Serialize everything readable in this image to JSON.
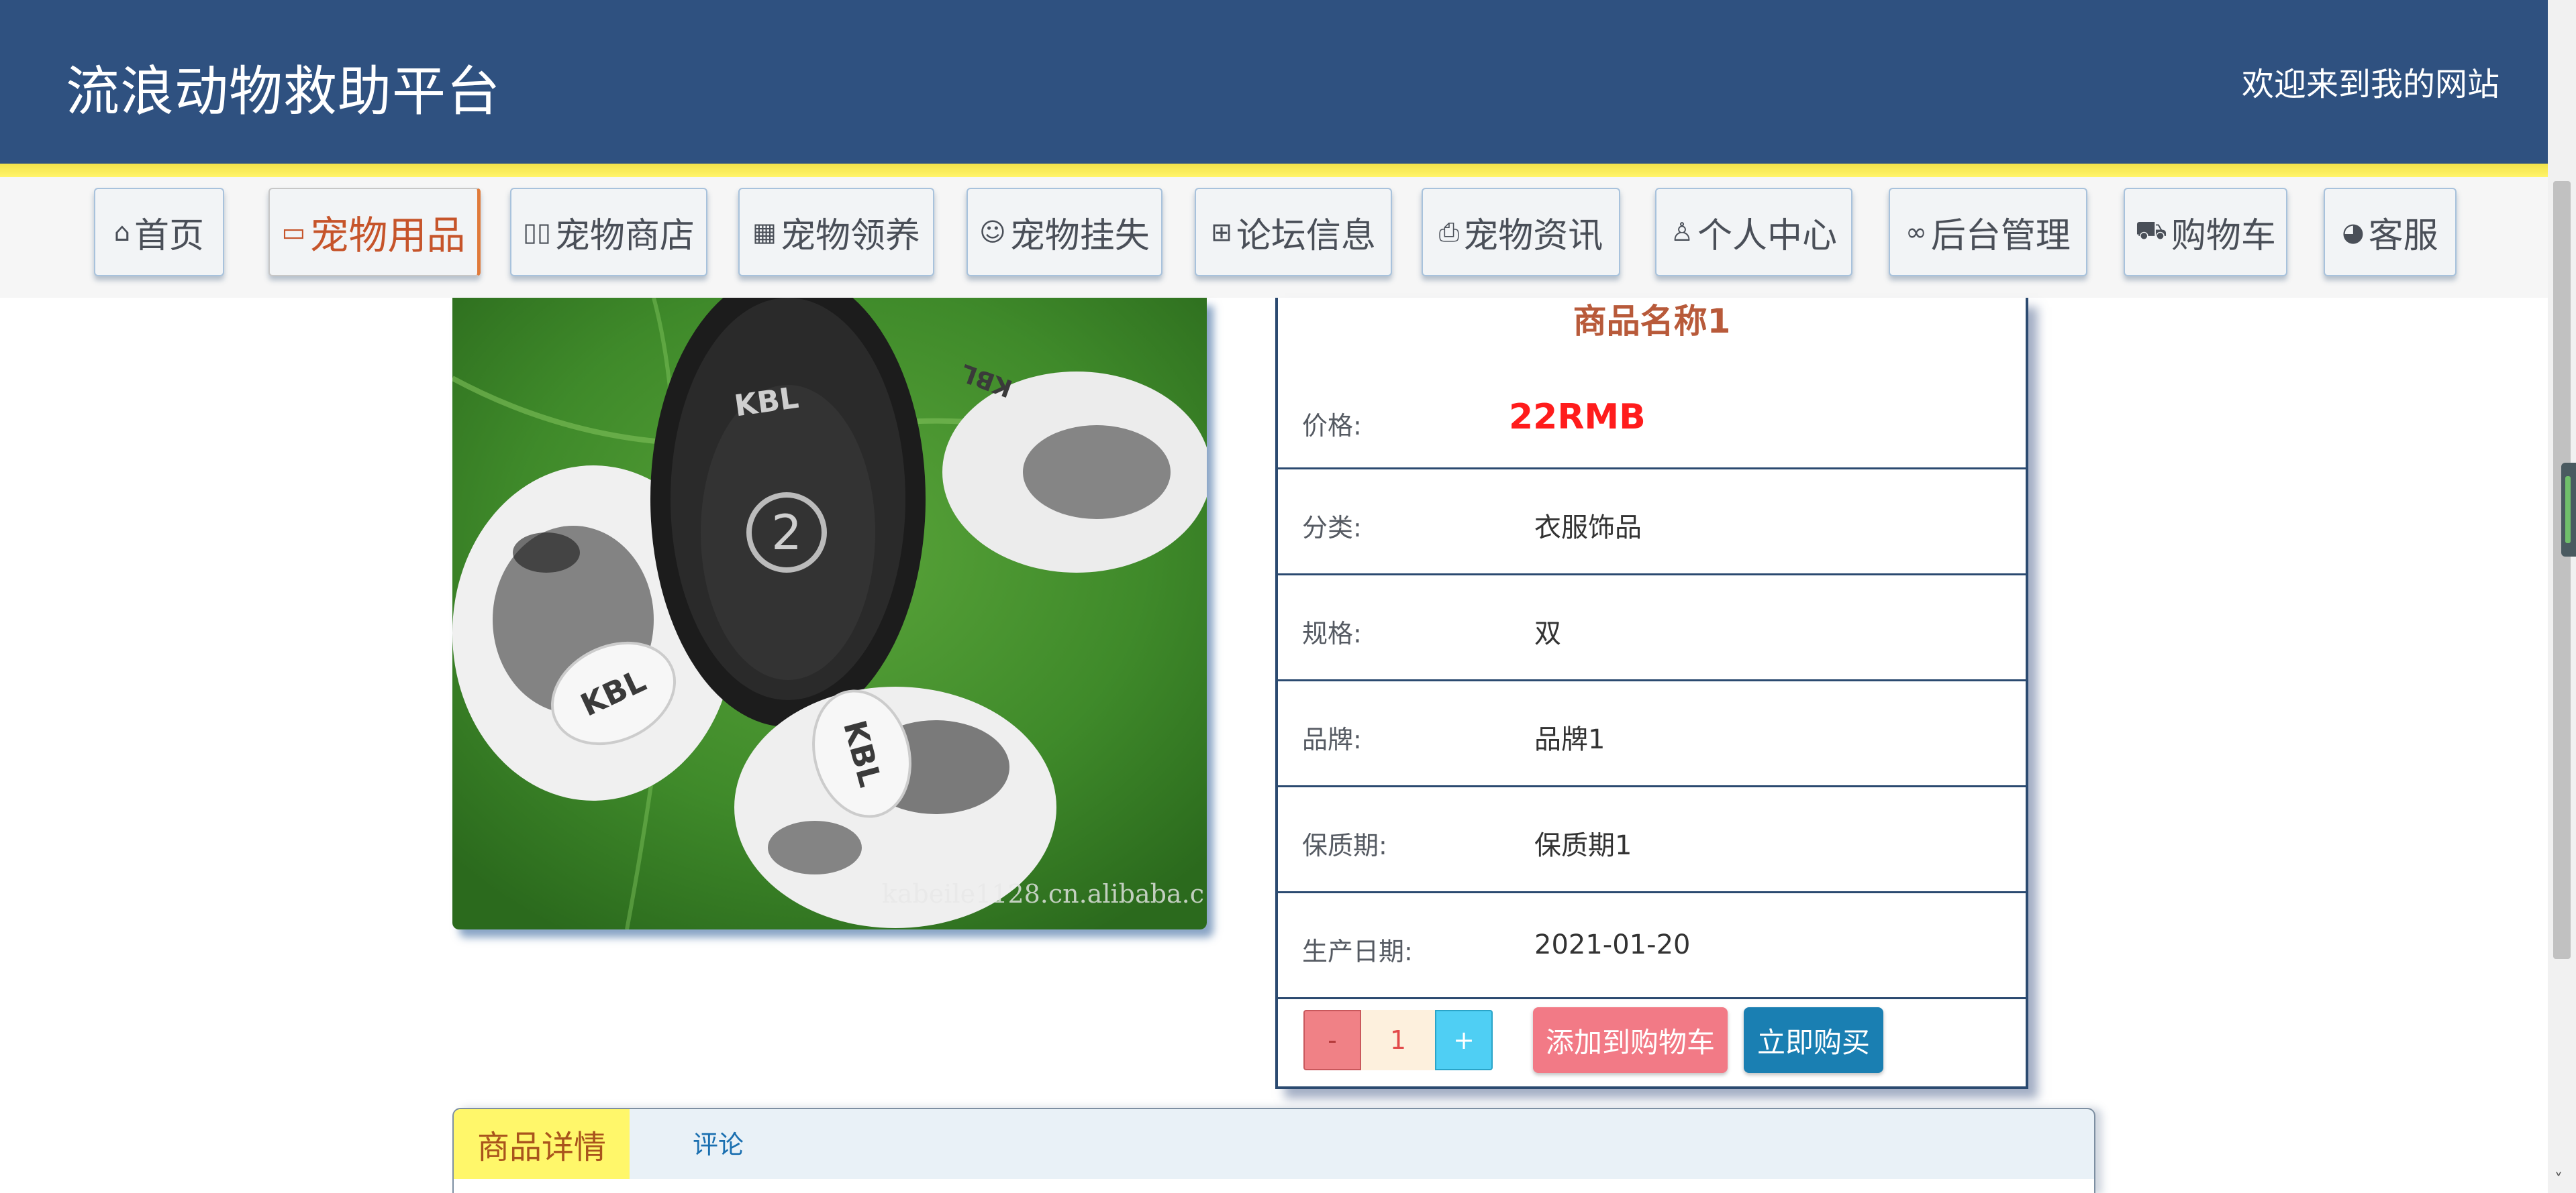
{
  "header": {
    "site_title": "流浪动物救助平台",
    "welcome": "欢迎来到我的网站"
  },
  "nav": {
    "items": [
      {
        "label": "首页",
        "icon": "home-icon",
        "glyph": "⌂"
      },
      {
        "label": "宠物用品",
        "icon": "document-icon",
        "glyph": "🗋"
      },
      {
        "label": "宠物商店",
        "icon": "columns-icon",
        "glyph": "▯▯"
      },
      {
        "label": "宠物领养",
        "icon": "grid-icon",
        "glyph": "▦"
      },
      {
        "label": "宠物挂失",
        "icon": "face-icon",
        "glyph": "☺"
      },
      {
        "label": "论坛信息",
        "icon": "apps-icon",
        "glyph": "⊞"
      },
      {
        "label": "宠物资讯",
        "icon": "printer-icon",
        "glyph": "⎙"
      },
      {
        "label": "个人中心",
        "icon": "user-icon",
        "glyph": "♙"
      },
      {
        "label": "后台管理",
        "icon": "link-icon",
        "glyph": "🔗"
      },
      {
        "label": "购物车",
        "icon": "cart-icon",
        "glyph": "🛒"
      },
      {
        "label": "客服",
        "icon": "chat-icon",
        "glyph": "◕"
      }
    ],
    "active_index": 1
  },
  "product": {
    "name": "商品名称1",
    "price_label": "价格:",
    "price": "22RMB",
    "category_label": "分类:",
    "category": "衣服饰品",
    "spec_label": "规格:",
    "spec": "双",
    "brand_label": "品牌:",
    "brand": "品牌1",
    "shelf_life_label": "保质期:",
    "shelf_life": "保质期1",
    "production_date_label": "生产日期:",
    "production_date": "2021-01-20",
    "image_watermark": "kabeile1128.cn.alibaba.c",
    "sole_brand": "KBL",
    "sole_number": "2"
  },
  "purchase": {
    "minus": "-",
    "quantity": "1",
    "plus": "+",
    "add_to_cart": "添加到购物车",
    "buy_now": "立即购买"
  },
  "tabs": {
    "details": "商品详情",
    "comments": "评论"
  },
  "colors": {
    "header_bg": "#2f5180",
    "active_nav": "#c6542a",
    "price": "#ff1c1c",
    "buy_button": "#1a7fb2",
    "cart_button": "#f27a86"
  }
}
